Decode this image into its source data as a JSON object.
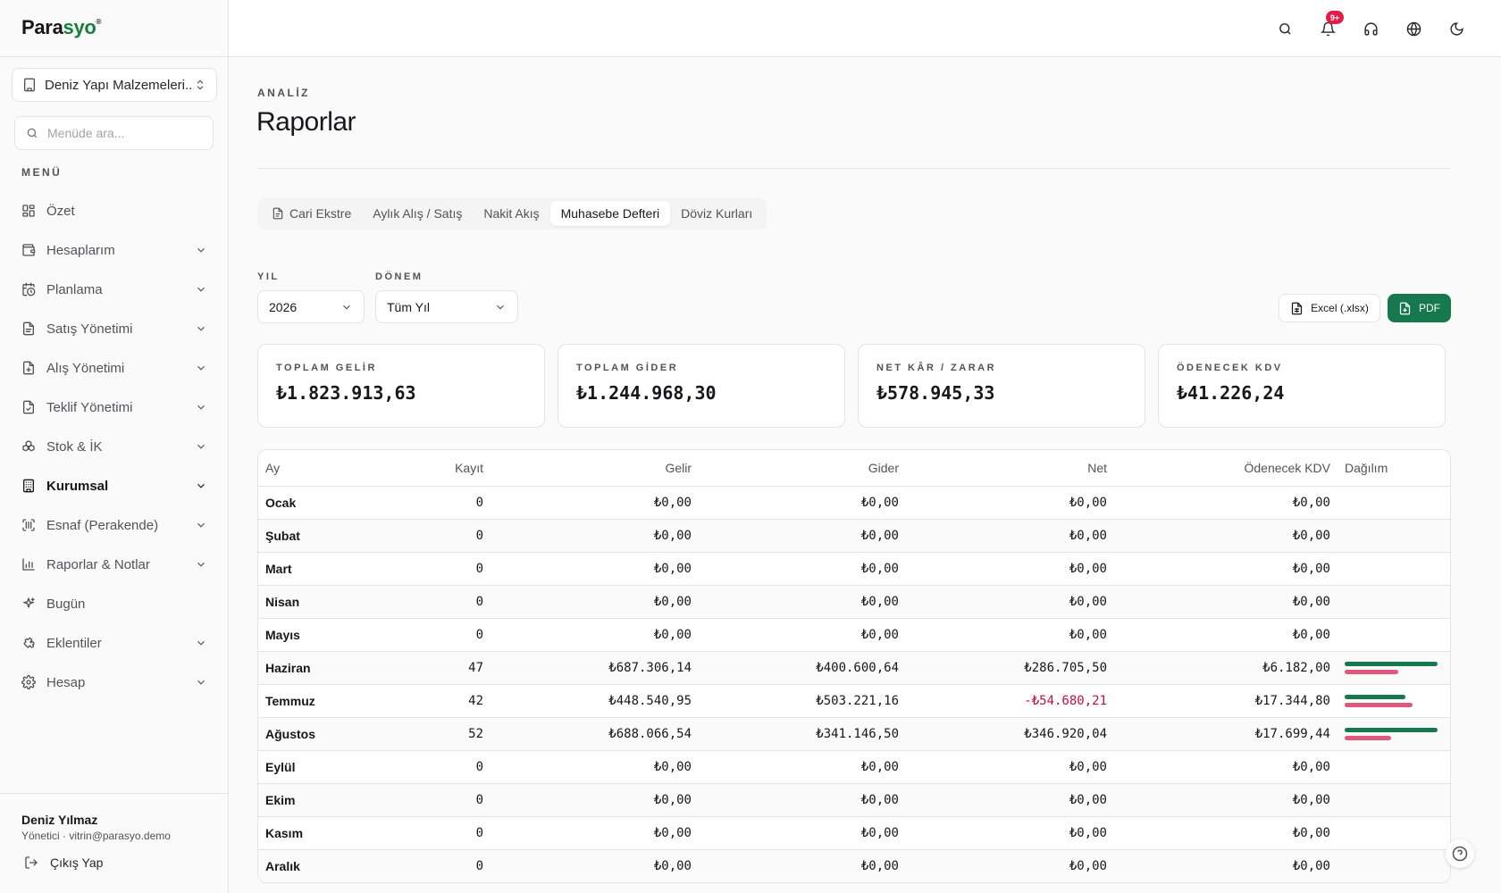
{
  "brand": {
    "name_part1": "Para",
    "name_part2": "syo",
    "mark": "®"
  },
  "company_selector": {
    "value": "Deniz Yapı Malzemeleri..."
  },
  "sidebar_search": {
    "placeholder": "Menüde ara..."
  },
  "menu_label": "MENÜ",
  "sidebar": {
    "items": [
      {
        "label": "Özet",
        "icon": "dashboard-icon",
        "has_chevron": false
      },
      {
        "label": "Hesaplarım",
        "icon": "wallet-icon",
        "has_chevron": true
      },
      {
        "label": "Planlama",
        "icon": "calendar-clock-icon",
        "has_chevron": true
      },
      {
        "label": "Satış Yönetimi",
        "icon": "document-icon",
        "has_chevron": true
      },
      {
        "label": "Alış Yönetimi",
        "icon": "document-plus-icon",
        "has_chevron": true
      },
      {
        "label": "Teklif Yönetimi",
        "icon": "document-check-icon",
        "has_chevron": true
      },
      {
        "label": "Stok & İK",
        "icon": "boxes-icon",
        "has_chevron": true
      },
      {
        "label": "Kurumsal",
        "icon": "building-icon",
        "has_chevron": true,
        "active": true
      },
      {
        "label": "Esnaf (Perakende)",
        "icon": "scan-icon",
        "has_chevron": true
      },
      {
        "label": "Raporlar & Notlar",
        "icon": "bar-chart-icon",
        "has_chevron": true
      },
      {
        "label": "Bugün",
        "icon": "sparkles-icon",
        "has_chevron": false
      },
      {
        "label": "Eklentiler",
        "icon": "puzzle-icon",
        "has_chevron": true
      },
      {
        "label": "Hesap",
        "icon": "gear-icon",
        "has_chevron": true
      }
    ]
  },
  "user": {
    "name": "Deniz Yılmaz",
    "role_email": "Yönetici · vitrin@parasyo.demo",
    "logout_label": "Çıkış Yap"
  },
  "topbar": {
    "notification_badge": "9+"
  },
  "header": {
    "eyebrow": "ANALİZ",
    "title": "Raporlar"
  },
  "tabs": [
    {
      "label": "Cari Ekstre",
      "icon": "document-icon"
    },
    {
      "label": "Aylık Alış / Satış"
    },
    {
      "label": "Nakit Akış"
    },
    {
      "label": "Muhasebe Defteri",
      "active": true
    },
    {
      "label": "Döviz Kurları"
    }
  ],
  "filters": {
    "year_label": "YIL",
    "year_value": "2026",
    "period_label": "DÖNEM",
    "period_value": "Tüm Yıl"
  },
  "export": {
    "excel_label": "Excel (.xlsx)",
    "pdf_label": "PDF"
  },
  "summary_cards": [
    {
      "label": "TOPLAM GELİR",
      "value": "₺1.823.913,63"
    },
    {
      "label": "TOPLAM GİDER",
      "value": "₺1.244.968,30"
    },
    {
      "label": "NET KÂR / ZARAR",
      "value": "₺578.945,33"
    },
    {
      "label": "ÖDENECEK KDV",
      "value": "₺41.226,24"
    }
  ],
  "table": {
    "columns": [
      "Ay",
      "Kayıt",
      "Gelir",
      "Gider",
      "Net",
      "Ödenecek KDV",
      "Dağılım"
    ],
    "rows": [
      {
        "month": "Ocak",
        "count": "0",
        "income": "₺0,00",
        "expense": "₺0,00",
        "net": "₺0,00",
        "vat": "₺0,00",
        "income_share": 0,
        "expense_share": 0
      },
      {
        "month": "Şubat",
        "count": "0",
        "income": "₺0,00",
        "expense": "₺0,00",
        "net": "₺0,00",
        "vat": "₺0,00",
        "income_share": 0,
        "expense_share": 0
      },
      {
        "month": "Mart",
        "count": "0",
        "income": "₺0,00",
        "expense": "₺0,00",
        "net": "₺0,00",
        "vat": "₺0,00",
        "income_share": 0,
        "expense_share": 0
      },
      {
        "month": "Nisan",
        "count": "0",
        "income": "₺0,00",
        "expense": "₺0,00",
        "net": "₺0,00",
        "vat": "₺0,00",
        "income_share": 0,
        "expense_share": 0
      },
      {
        "month": "Mayıs",
        "count": "0",
        "income": "₺0,00",
        "expense": "₺0,00",
        "net": "₺0,00",
        "vat": "₺0,00",
        "income_share": 0,
        "expense_share": 0
      },
      {
        "month": "Haziran",
        "count": "47",
        "income": "₺687.306,14",
        "expense": "₺400.600,64",
        "net": "₺286.705,50",
        "vat": "₺6.182,00",
        "income_share": 1.0,
        "expense_share": 0.58
      },
      {
        "month": "Temmuz",
        "count": "42",
        "income": "₺448.540,95",
        "expense": "₺503.221,16",
        "net": "-₺54.680,21",
        "vat": "₺17.344,80",
        "negative": true,
        "income_share": 0.65,
        "expense_share": 0.73
      },
      {
        "month": "Ağustos",
        "count": "52",
        "income": "₺688.066,54",
        "expense": "₺341.146,50",
        "net": "₺346.920,04",
        "vat": "₺17.699,44",
        "income_share": 1.0,
        "expense_share": 0.5
      },
      {
        "month": "Eylül",
        "count": "0",
        "income": "₺0,00",
        "expense": "₺0,00",
        "net": "₺0,00",
        "vat": "₺0,00",
        "income_share": 0,
        "expense_share": 0
      },
      {
        "month": "Ekim",
        "count": "0",
        "income": "₺0,00",
        "expense": "₺0,00",
        "net": "₺0,00",
        "vat": "₺0,00",
        "income_share": 0,
        "expense_share": 0
      },
      {
        "month": "Kasım",
        "count": "0",
        "income": "₺0,00",
        "expense": "₺0,00",
        "net": "₺0,00",
        "vat": "₺0,00",
        "income_share": 0,
        "expense_share": 0
      },
      {
        "month": "Aralık",
        "count": "0",
        "income": "₺0,00",
        "expense": "₺0,00",
        "net": "₺0,00",
        "vat": "₺0,00",
        "income_share": 0,
        "expense_share": 0
      }
    ]
  },
  "colors": {
    "brand_green": "#16794e",
    "expense_pink": "#e0587b",
    "negative": "#be123c",
    "badge": "#e11d48"
  }
}
